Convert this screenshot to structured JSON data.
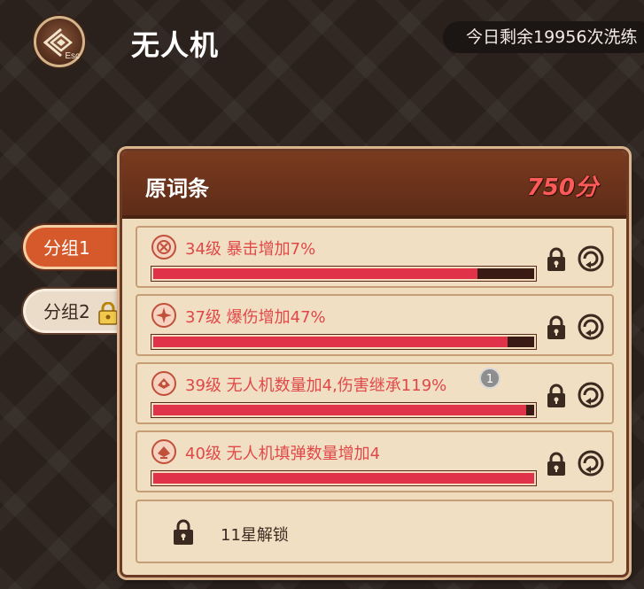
{
  "header": {
    "back_icon_label": "Esc",
    "title": "无人机",
    "refresh_text": "今日剩余19956次洗练"
  },
  "groups": [
    {
      "label": "分组1",
      "active": true,
      "locked": false
    },
    {
      "label": "分组2",
      "active": false,
      "locked": true
    }
  ],
  "panel": {
    "title": "原词条",
    "score": "750分"
  },
  "affixes": [
    {
      "text": "34级 暴击增加7%",
      "progress": 0.85,
      "icon": "crit-affix-icon"
    },
    {
      "text": "37级 爆伤增加47%",
      "progress": 0.93,
      "icon": "crit-damage-affix-icon"
    },
    {
      "text": "39级 无人机数量加4,伤害继承119%",
      "progress": 0.98,
      "icon": "drone-affix-icon",
      "badge": "1"
    },
    {
      "text": "40级 无人机填弹数量增加4",
      "progress": 1.0,
      "icon": "drone-ammo-affix-icon"
    }
  ],
  "locked_slot": {
    "text": "11星解锁"
  },
  "colors": {
    "accent_red": "#e0334a",
    "text_red": "#e04848",
    "score_red": "#ff5a5a",
    "active_tab": "#d5592a",
    "header_brown": "#6b3220"
  }
}
